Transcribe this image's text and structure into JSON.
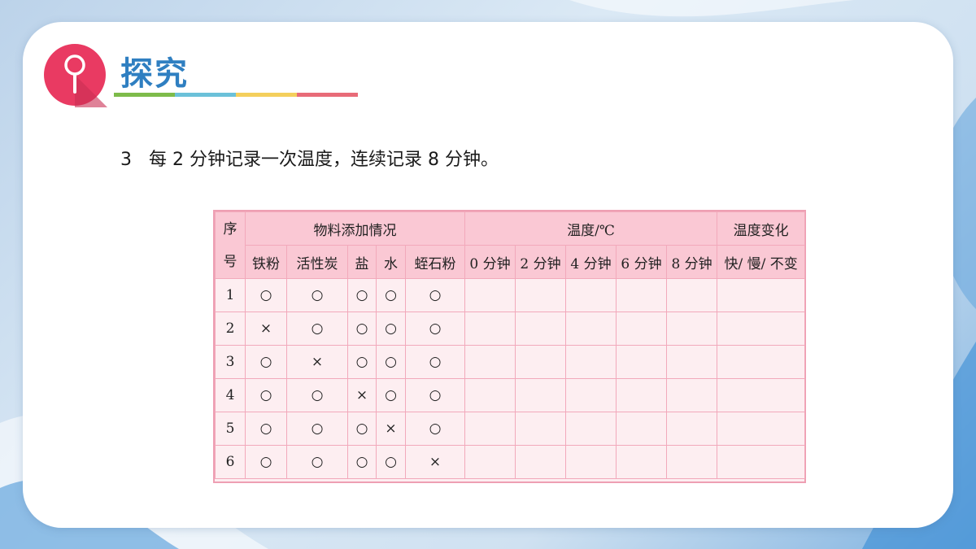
{
  "header": {
    "title": "探究"
  },
  "accent_colors": [
    "#7dbb4a",
    "#6bc1d9",
    "#f4cf5c",
    "#e86b78"
  ],
  "logo": {
    "icon": "magnifier-icon",
    "color": "#e93a62"
  },
  "instruction": "3   每 2 分钟记录一次温度，连续记录 8 分钟。",
  "table": {
    "seq_header": [
      "序",
      "号"
    ],
    "group_headers": {
      "materials": "物料添加情况",
      "temperature": "温度/℃",
      "change": "温度变化"
    },
    "material_columns": [
      "铁粉",
      "活性炭",
      "盐",
      "水",
      "蛭石粉"
    ],
    "time_columns": [
      "0 分钟",
      "2 分钟",
      "4 分钟",
      "6 分钟",
      "8 分钟"
    ],
    "change_column": "快/ 慢/ 不变",
    "rows": [
      {
        "seq": "1",
        "marks": [
          "○",
          "○",
          "○",
          "○",
          "○"
        ]
      },
      {
        "seq": "2",
        "marks": [
          "×",
          "○",
          "○",
          "○",
          "○"
        ]
      },
      {
        "seq": "3",
        "marks": [
          "○",
          "×",
          "○",
          "○",
          "○"
        ]
      },
      {
        "seq": "4",
        "marks": [
          "○",
          "○",
          "×",
          "○",
          "○"
        ]
      },
      {
        "seq": "5",
        "marks": [
          "○",
          "○",
          "○",
          "×",
          "○"
        ]
      },
      {
        "seq": "6",
        "marks": [
          "○",
          "○",
          "○",
          "○",
          "×"
        ]
      }
    ]
  }
}
